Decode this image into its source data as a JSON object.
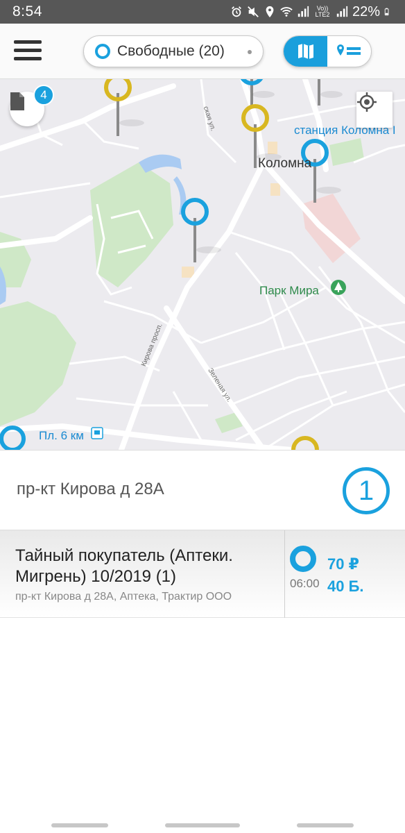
{
  "status_bar": {
    "time": "8:54",
    "network_label": "Vo)) LTE2",
    "battery": "22%"
  },
  "header": {
    "filter_label": "Свободные (20)"
  },
  "map": {
    "badge_count": "4",
    "labels": {
      "station": "станция Коломна I",
      "city": "Коломна",
      "park": "Парк Мира",
      "platform": "Пл. 6 км",
      "street_kirova": "Кирова просп.",
      "street_zelenaya": "Зеленая ул.",
      "street_top": "ская ул."
    }
  },
  "address_panel": {
    "address": "пр-кт Кирова д 28А",
    "count": "1"
  },
  "task": {
    "title": "Тайный покупатель (Аптеки. Мигрень) 10/2019 (1)",
    "subtitle": "пр-кт Кирова д 28А, Аптека, Трактир ООО",
    "time": "06:00",
    "price": "70 ₽",
    "points": "40 Б."
  },
  "colors": {
    "accent": "#1aa1de",
    "pin_yellow": "#d8b721",
    "park_green": "#cfe8c7",
    "map_bg": "#ecebef"
  }
}
